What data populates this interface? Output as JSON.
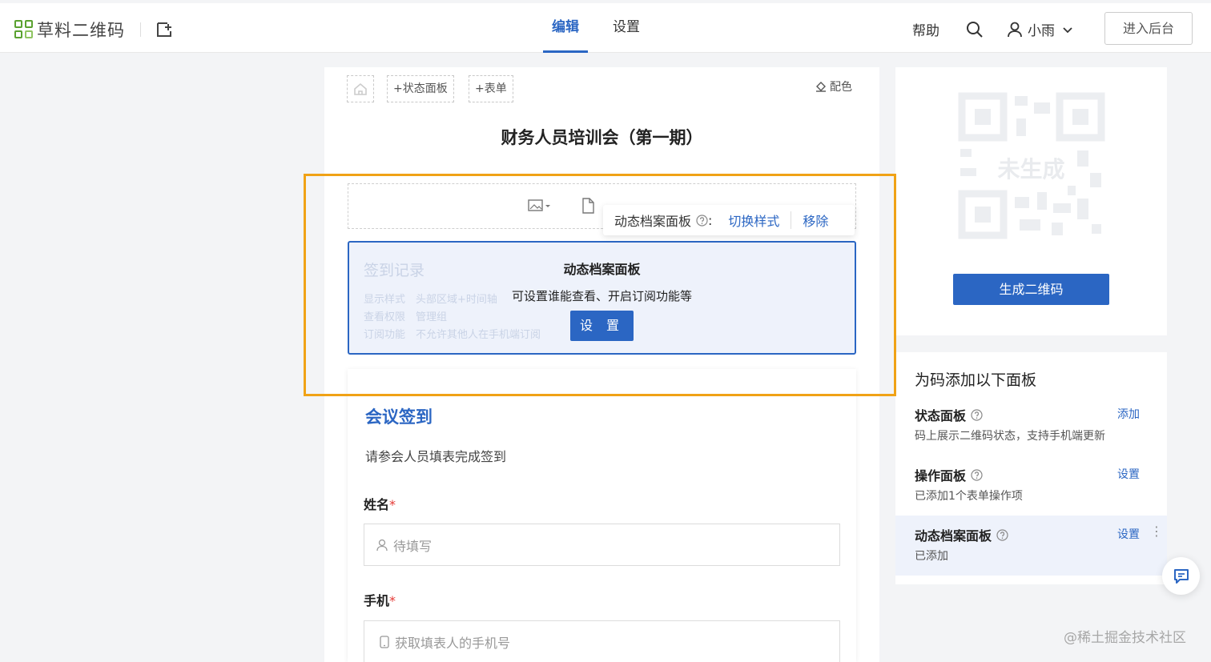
{
  "header": {
    "logo_text": "草料二维码",
    "tabs": [
      {
        "label": "编辑",
        "active": true
      },
      {
        "label": "设置",
        "active": false
      }
    ],
    "help_label": "帮助",
    "user_name": "小雨",
    "backend_button": "进入后台"
  },
  "editor": {
    "toolbar": {
      "add_status_panel": "+状态面板",
      "add_form": "+表单",
      "color_label": "配色"
    },
    "page_title": "财务人员培训会（第一期）",
    "panel_popover": {
      "title": "动态档案面板",
      "colon": ":",
      "switch_style": "切换样式",
      "remove": "移除"
    },
    "dynamic_panel": {
      "ghost_title": "签到记录",
      "ghost_lines": [
        "显示样式　头部区域+时间轴",
        "查看权限　管理组",
        "订阅功能　不允许其他人在手机端订阅"
      ],
      "title": "动态档案面板",
      "description": "可设置谁能查看、开启订阅功能等",
      "button": "设 置"
    },
    "form": {
      "title": "会议签到",
      "description": "请参会人员填表完成签到",
      "fields": [
        {
          "label": "姓名",
          "required_mark": "*",
          "placeholder": "待填写",
          "icon": "user-icon"
        },
        {
          "label": "手机",
          "required_mark": "*",
          "placeholder": "获取填表人的手机号",
          "icon": "phone-icon"
        }
      ]
    }
  },
  "qr_card": {
    "status_text": "未生成",
    "generate_button": "生成二维码"
  },
  "panels_card": {
    "title": "为码添加以下面板",
    "items": [
      {
        "name": "状态面板",
        "description": "码上展示二维码状态，支持手机端更新",
        "action": "添加",
        "selected": false
      },
      {
        "name": "操作面板",
        "description": "已添加1个表单操作项",
        "action": "设置",
        "selected": false
      },
      {
        "name": "动态档案面板",
        "description": "已添加",
        "action": "设置",
        "selected": true
      }
    ]
  },
  "watermark": "@稀土掘金技术社区",
  "colors": {
    "primary": "#2b66c3",
    "highlight": "#f0a216",
    "logo_green": "#5aa130",
    "required": "#e53935"
  }
}
